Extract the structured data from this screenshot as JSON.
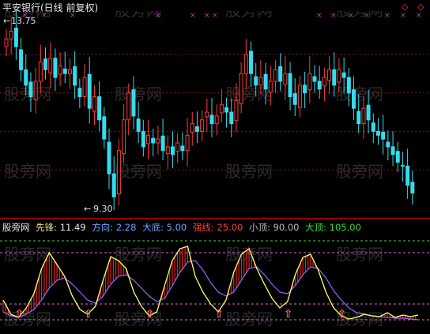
{
  "title": "平安银行(日线 前复权)",
  "top_controls": [
    "◇",
    "◇"
  ],
  "price_markers": {
    "high_label": "13.75",
    "low_label": "9.30",
    "high": 13.75,
    "low": 9.3
  },
  "watermark": "股旁网",
  "indicator": {
    "name": "股旁网",
    "items": [
      {
        "label": "先锋:",
        "value": "11.49",
        "color": "#e8e8e8",
        "label_color": "#f0e68c"
      },
      {
        "label": "方向:",
        "value": "2.28",
        "color": "#6aa8ff",
        "label_color": "#6aa8ff"
      },
      {
        "label": "大底:",
        "value": "5.00",
        "color": "#6aa8ff",
        "label_color": "#6aa8ff"
      },
      {
        "label": "强线:",
        "value": "25.00",
        "color": "#ff3b3b",
        "label_color": "#ff3b3b"
      },
      {
        "label": "小顶:",
        "value": "90.00",
        "color": "#bbbbbb",
        "label_color": "#bbbbbb"
      },
      {
        "label": "大顶:",
        "value": "105.00",
        "color": "#33dd33",
        "label_color": "#33dd33"
      }
    ]
  },
  "colors": {
    "up": "#ff3b3b",
    "down": "#33ddee",
    "accent_magenta": "#cc33cc",
    "dash_green": "#33dd33",
    "dash_pink": "#dd66dd",
    "line_yellow": "#ffff66",
    "line_purple": "#9966ff"
  },
  "chart_data": [
    {
      "type": "candlestick",
      "title": "平安银行(日线 前复权)",
      "ylim": [
        9.0,
        14.0
      ],
      "closes": [
        13.4,
        13.6,
        13.2,
        12.6,
        12.2,
        11.9,
        12.3,
        12.8,
        12.6,
        12.9,
        12.4,
        12.7,
        12.5,
        12.6,
        12.2,
        11.9,
        12.4,
        11.6,
        11.9,
        11.3,
        10.8,
        9.9,
        9.3,
        10.5,
        11.3,
        12.0,
        11.4,
        11.0,
        10.6,
        10.9,
        10.7,
        10.8,
        10.5,
        10.6,
        10.4,
        10.7,
        10.5,
        10.9,
        11.2,
        11.0,
        11.3,
        11.5,
        11.2,
        11.4,
        11.7,
        11.5,
        11.2,
        11.8,
        12.5,
        13.0,
        12.5,
        12.2,
        12.4,
        12.1,
        12.3,
        12.6,
        12.3,
        12.5,
        11.9,
        11.7,
        12.2,
        12.0,
        12.5,
        12.3,
        12.1,
        12.4,
        12.6,
        12.2,
        12.6,
        12.4,
        12.0,
        11.6,
        11.2,
        11.6,
        11.3,
        11.0,
        10.9,
        10.8,
        10.6,
        10.4,
        10.2,
        10.1,
        9.6,
        9.4
      ]
    },
    {
      "type": "line",
      "title": "股旁网",
      "ylim": [
        -10,
        110
      ],
      "series": [
        {
          "name": "先锋",
          "values": [
            30,
            12,
            8,
            20,
            38,
            70,
            90,
            75,
            60,
            35,
            18,
            12,
            22,
            55,
            85,
            80,
            70,
            40,
            22,
            10,
            15,
            48,
            80,
            95,
            98,
            60,
            40,
            25,
            15,
            30,
            65,
            88,
            95,
            70,
            50,
            32,
            20,
            28,
            62,
            84,
            88,
            68,
            40,
            20,
            10,
            6,
            8,
            12,
            10,
            9,
            14,
            8,
            11,
            9,
            11
          ]
        },
        {
          "name": "方向",
          "values": [
            15,
            10,
            8,
            12,
            18,
            30,
            45,
            55,
            58,
            50,
            40,
            30,
            26,
            35,
            50,
            60,
            62,
            55,
            45,
            35,
            28,
            32,
            48,
            65,
            78,
            80,
            68,
            52,
            40,
            35,
            40,
            55,
            70,
            72,
            62,
            50,
            40,
            38,
            48,
            62,
            72,
            70,
            58,
            42,
            30,
            20,
            14,
            12,
            10,
            9,
            8,
            7,
            7,
            6,
            5
          ]
        }
      ],
      "reference_lines": [
        {
          "name": "大底",
          "value": 5
        },
        {
          "name": "强线",
          "value": 25
        },
        {
          "name": "小顶",
          "value": 90
        },
        {
          "name": "大顶",
          "value": 105
        }
      ]
    }
  ]
}
